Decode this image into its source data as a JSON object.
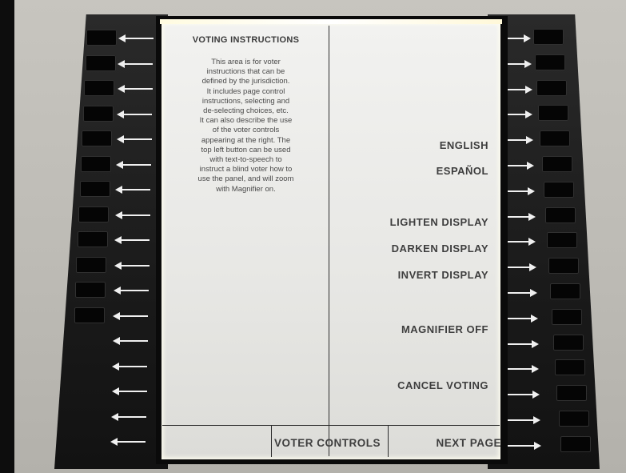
{
  "instructions": {
    "title": "VOTING INSTRUCTIONS",
    "lines": [
      "This area is for voter",
      "instructions that can be",
      "defined by the jurisdiction.",
      "It includes page control",
      "instructions, selecting and",
      "de-selecting choices, etc.",
      "It can also describe the use",
      "of the voter controls",
      "appearing at the right.  The",
      "top left button can be used",
      "with text-to-speech to",
      "instruct a blind voter how to",
      "use the panel, and will zoom",
      "with Magnifier on."
    ]
  },
  "controls": {
    "english": "ENGLISH",
    "espanol": "ESPAÑOL",
    "lighten": "LIGHTEN DISPLAY",
    "darken": "DARKEN DISPLAY",
    "invert": "INVERT DISPLAY",
    "magnifier": "MAGNIFIER OFF",
    "cancel": "CANCEL VOTING"
  },
  "bottom_bar": {
    "voter_controls": "VOTER CONTROLS",
    "next_page": "NEXT PAGE"
  },
  "colors": {
    "screen": "#ececea",
    "bezel": "#1c1c1c",
    "text": "#3e3e3e",
    "arrow": "#f0f0f0"
  },
  "icons": {
    "left_buttons": "arrow-left-icon",
    "right_buttons": "arrow-right-icon"
  }
}
